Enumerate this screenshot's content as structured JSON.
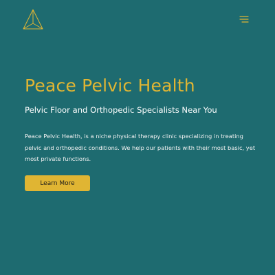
{
  "header": {
    "logo_icon": "triangle-pyramid-logo-icon",
    "menu_icon": "hamburger-menu-icon"
  },
  "hero": {
    "title": "Peace Pelvic Health",
    "subtitle": "Pelvic Floor and Orthopedic Specialists Near You",
    "description": "Peace Pelvic Health, is a niche physical therapy clinic specializing in treating pelvic and orthopedic conditions. We help our patients with their most basic, yet most private functions.",
    "cta_label": "Learn More"
  },
  "colors": {
    "background": "#1e6b70",
    "accent": "#e0b533",
    "text": "#ffffff"
  }
}
